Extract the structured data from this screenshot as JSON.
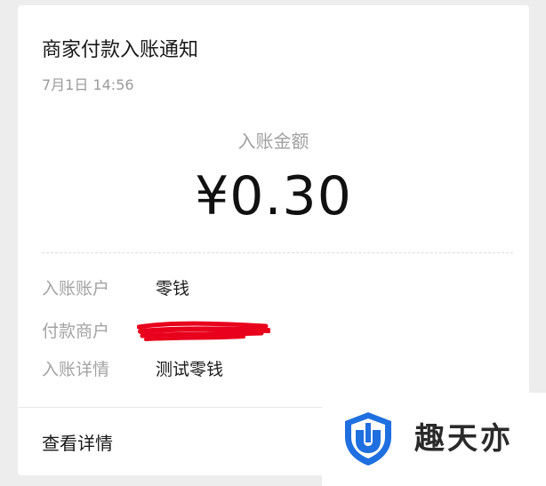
{
  "notification": {
    "title": "商家付款入账通知",
    "time": "7月1日  14:56",
    "amount_label": "入账金额",
    "amount": "¥0.30",
    "details": [
      {
        "key": "入账账户",
        "value": "零钱"
      },
      {
        "key": "付款商户",
        "value": ""
      },
      {
        "key": "入账详情",
        "value": "测试零钱"
      }
    ],
    "view_detail": "查看详情"
  },
  "watermark": {
    "text": "趣天亦",
    "logo_icon": "shield-logo-icon"
  },
  "colors": {
    "background": "#ededed",
    "card": "#ffffff",
    "redaction": "#e8001c",
    "logo_blue": "#1f6fe0"
  }
}
